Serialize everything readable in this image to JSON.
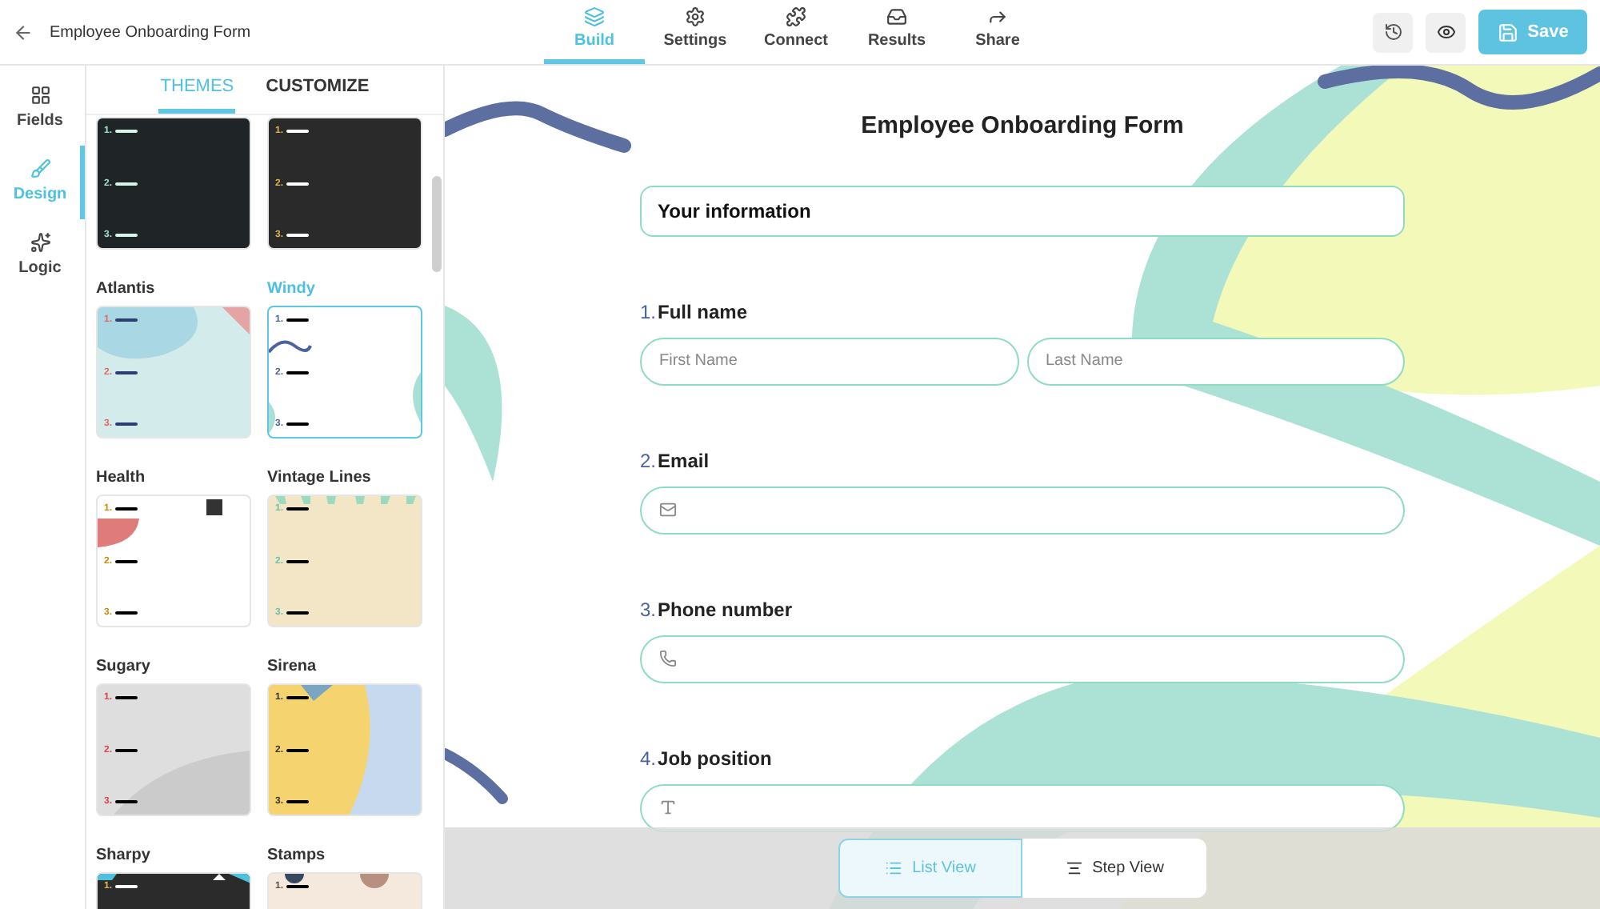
{
  "header": {
    "title": "Employee Onboarding Form",
    "tabs": [
      {
        "label": "Build",
        "selected": true
      },
      {
        "label": "Settings",
        "selected": false
      },
      {
        "label": "Connect",
        "selected": false
      },
      {
        "label": "Results",
        "selected": false
      },
      {
        "label": "Share",
        "selected": false
      }
    ],
    "save": "Save"
  },
  "rail": [
    {
      "label": "Fields",
      "selected": false
    },
    {
      "label": "Design",
      "selected": true
    },
    {
      "label": "Logic",
      "selected": false
    }
  ],
  "panel": {
    "tabs": [
      {
        "label": "THEMES",
        "selected": true
      },
      {
        "label": "CUSTOMIZE",
        "selected": false
      }
    ],
    "themes": [
      {
        "kind": "dark",
        "selected": false,
        "marks": [
          "1.",
          "2.",
          "3."
        ]
      },
      {
        "kind": "chalk",
        "selected": false,
        "marks": [
          "1.",
          "2.",
          "3."
        ]
      },
      {
        "name": "Atlantis",
        "kind": "atlantis",
        "selected": false,
        "marks": [
          "1.",
          "2.",
          "3."
        ]
      },
      {
        "name": "Windy",
        "kind": "windy",
        "selected": true,
        "marks": [
          "1.",
          "2.",
          "3."
        ]
      },
      {
        "name": "Health",
        "kind": "health",
        "selected": false,
        "marks": [
          "1.",
          "2.",
          "3."
        ]
      },
      {
        "name": "Vintage Lines",
        "kind": "vintage",
        "selected": false,
        "marks": [
          "1.",
          "2.",
          "3."
        ]
      },
      {
        "name": "Sugary",
        "kind": "sugary",
        "selected": false,
        "marks": [
          "1.",
          "2.",
          "3."
        ]
      },
      {
        "name": "Sirena",
        "kind": "sirena",
        "selected": false,
        "marks": [
          "1.",
          "2.",
          "3."
        ]
      },
      {
        "name": "Sharpy",
        "kind": "sharpy",
        "selected": false,
        "marks": [
          "1."
        ]
      },
      {
        "name": "Stamps",
        "kind": "stamps",
        "selected": false,
        "marks": [
          "1."
        ]
      }
    ]
  },
  "form": {
    "title": "Employee Onboarding Form",
    "section": "Your information",
    "questions": [
      {
        "number": "1.",
        "label": "Full name",
        "kind": "name",
        "placeholders": [
          "First Name",
          "Last Name"
        ]
      },
      {
        "number": "2.",
        "label": "Email",
        "kind": "email"
      },
      {
        "number": "3.",
        "label": "Phone number",
        "kind": "phone"
      },
      {
        "number": "4.",
        "label": "Job position",
        "kind": "text"
      }
    ]
  },
  "views": [
    {
      "label": "List View",
      "kind": "list",
      "selected": true
    },
    {
      "label": "Step View",
      "kind": "step",
      "selected": false
    }
  ]
}
